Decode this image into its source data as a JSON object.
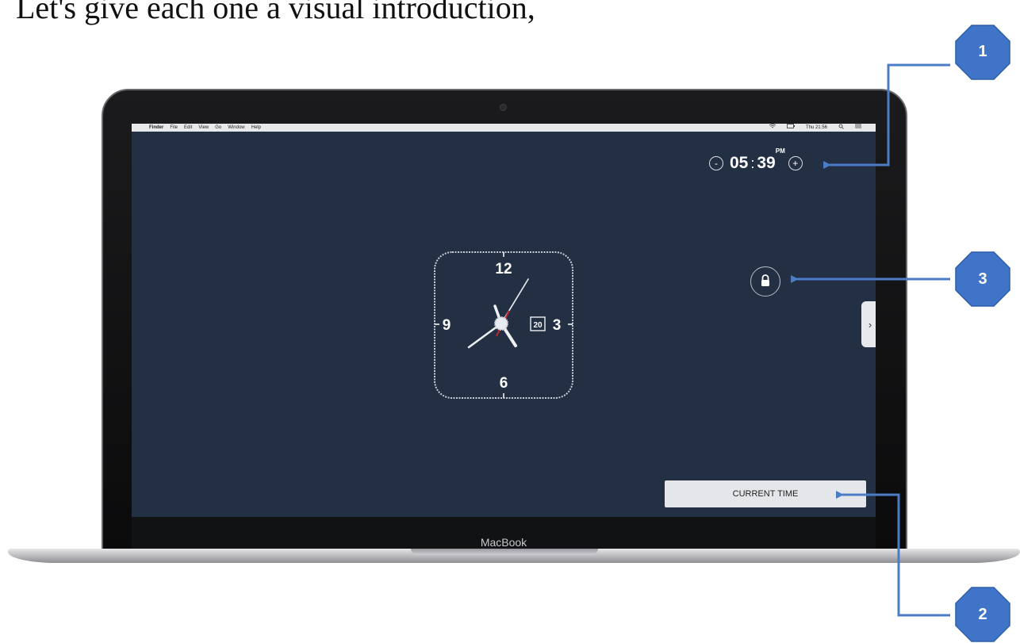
{
  "caption": "Let's give each one a visual introduction,",
  "laptop": {
    "brand": "MacBook"
  },
  "menubar": {
    "apple_icon": "",
    "items": [
      "Finder",
      "File",
      "Edit",
      "View",
      "Go",
      "Window",
      "Help"
    ],
    "clock": "Thu 21:56"
  },
  "time_widget": {
    "decrement": "-",
    "hour": "05",
    "separator": ":",
    "minute": "39",
    "ampm": "PM",
    "increment": "+"
  },
  "analog_clock": {
    "numerals": [
      "12",
      "3",
      "6",
      "9"
    ],
    "date": "20"
  },
  "current_time_button": {
    "label": "CURRENT TIME"
  },
  "side_tab": {
    "icon": "chevron-right-icon",
    "glyph": "›"
  },
  "lock_button": {
    "icon": "lock-icon"
  },
  "callouts": [
    "1",
    "2",
    "3"
  ],
  "colors": {
    "screen_bg": "#233044",
    "callout_fill": "#3f74c8",
    "callout_arrow": "#4b7cc6"
  }
}
